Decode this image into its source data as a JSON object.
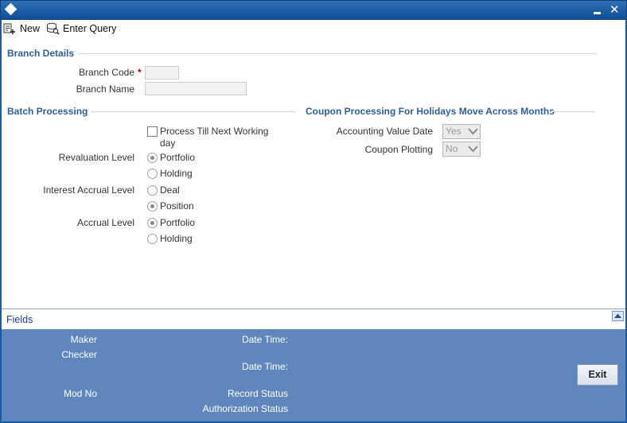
{
  "window": {
    "minimize_icon": "minimize-icon",
    "close_glyph": "✕"
  },
  "toolbar": {
    "new_label": "New",
    "enter_query_label": "Enter Query"
  },
  "branch_details": {
    "title": "Branch Details",
    "branch_code_label": "Branch Code",
    "required_marker": "*",
    "branch_code_value": "",
    "branch_name_label": "Branch Name",
    "branch_name_value": ""
  },
  "batch_processing": {
    "title": "Batch Processing",
    "process_till_next_working_day_line1": "Process Till Next Working",
    "process_till_next_working_day_line2": "day",
    "process_till_next_working_day_checked": false,
    "revaluation_level_label": "Revaluation Level",
    "revaluation_options": [
      "Portfolio",
      "Holding"
    ],
    "revaluation_selected": "Portfolio",
    "interest_accrual_level_label": "Interest Accrual Level",
    "interest_accrual_options": [
      "Deal",
      "Position"
    ],
    "interest_accrual_selected": "Position",
    "accrual_level_label": "Accrual Level",
    "accrual_options": [
      "Portfolio",
      "Holding"
    ],
    "accrual_selected": "Portfolio"
  },
  "coupon_processing": {
    "title": "Coupon Processing For Holidays Move Across Months",
    "accounting_value_date_label": "Accounting Value Date",
    "accounting_value_date_value": "Yes",
    "coupon_plotting_label": "Coupon Plotting",
    "coupon_plotting_value": "No"
  },
  "fields_bar": {
    "label": "Fields"
  },
  "audit": {
    "maker_label": "Maker",
    "checker_label": "Checker",
    "date_time_label_1": "Date Time:",
    "date_time_label_2": "Date Time:",
    "mod_no_label": "Mod No",
    "record_status_label": "Record Status",
    "authorization_status_label": "Authorization Status",
    "exit_label": "Exit"
  },
  "colors": {
    "title_bar": "#0d4f9a",
    "section_title": "#2f5f97",
    "audit_bg": "#5f86bd",
    "required": "#c00000"
  }
}
